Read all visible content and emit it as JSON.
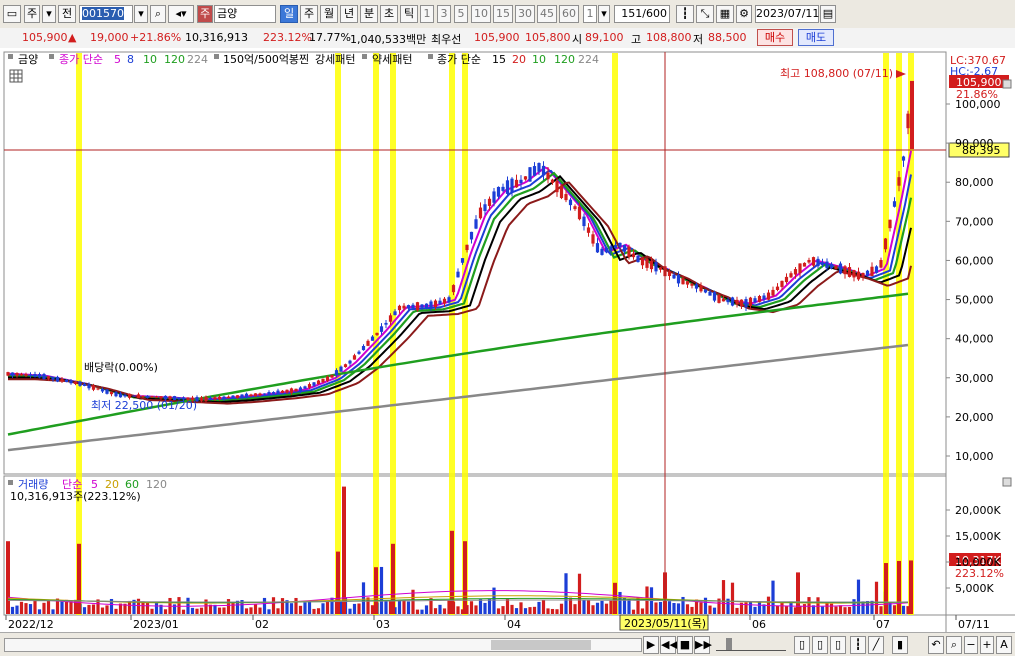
{
  "toolbar": {
    "market": "주",
    "prev_label": "전",
    "code_highlight": "001570",
    "stock_name": "금양",
    "market_tag": "주",
    "periods": [
      "일",
      "주",
      "월",
      "년",
      "분",
      "초",
      "틱"
    ],
    "selected_period": "일",
    "intervals": [
      "1",
      "3",
      "5",
      "10",
      "15",
      "30",
      "45",
      "60"
    ],
    "count_unit": "1",
    "bar_count": "151",
    "bar_total": "/600",
    "date": "2023/07/11"
  },
  "quote": {
    "price": "105,900",
    "arrow": "▲",
    "change": "19,000",
    "change_pct": "+21.86%",
    "volume": "10,316,913",
    "volume_ratio": "223.12%",
    "turnover": "17.77%",
    "amount": "1,040,533백만",
    "priority_label": "최우선",
    "ask": "105,900",
    "bid": "105,800",
    "open_label": "시",
    "open": "89,100",
    "high_label": "고",
    "high": "108,800",
    "low_label": "저",
    "low": "88,500",
    "buy_label": "매수",
    "sell_label": "매도"
  },
  "legend": {
    "name": "금양",
    "ma_label": "종가 단순",
    "ma_periods": [
      "5",
      "8",
      "10",
      "120",
      "224"
    ],
    "ma_colors": [
      "#d000d0",
      "#1c3ed6",
      "#1f9e1f",
      "#1f9e1f",
      "#888888"
    ],
    "pattern1": "150억/500억봉찐",
    "pattern2": "강세패턴",
    "pattern3": "약세패턴",
    "ma2_label": "종가 단순",
    "ma2_periods": [
      "15",
      "20",
      "10",
      "120",
      "224"
    ],
    "ma2_colors": [
      "#000000",
      "#d21d1d",
      "#1f9e1f",
      "#1f9e1f",
      "#888888"
    ]
  },
  "price_chart": {
    "right_top": "LC:370.67",
    "right_top2": "HC:-2.67",
    "high_note": "최고 108,800 (07/11)",
    "low_note": "최저 22,500 (01/20)",
    "dividend_note": "배당락(0.00%)",
    "last_price_tag": "105,900",
    "last_pct_tag": "21.86%",
    "crosshair_tag": "88,395",
    "y_ticks": [
      "100,000",
      "90,000",
      "80,000",
      "70,000",
      "60,000",
      "50,000",
      "40,000",
      "30,000",
      "20,000",
      "10,000"
    ]
  },
  "volume_chart": {
    "legend_name": "거래량",
    "legend_ma": "단순",
    "legend_periods": [
      "5",
      "20",
      "60",
      "120"
    ],
    "legend_colors": [
      "#d000d0",
      "#c8a000",
      "#1f9e1f",
      "#888888"
    ],
    "value": "10,316,913주(223.12%)",
    "tag_value": "10,317K",
    "tag_pct": "223.12%",
    "y_ticks": [
      "20,000K",
      "15,000K",
      "10,000K",
      "5,000K"
    ]
  },
  "x_axis": {
    "labels": [
      "2022/12",
      "2023/01",
      "02",
      "03",
      "04",
      "06",
      "07",
      "07/11"
    ],
    "crosshair_date": "2023/05/11(목)"
  },
  "colors": {
    "up": "#d21d1d",
    "down": "#1c3ed6",
    "highlight": "#ffff00",
    "crosshair": "#b22222"
  }
}
